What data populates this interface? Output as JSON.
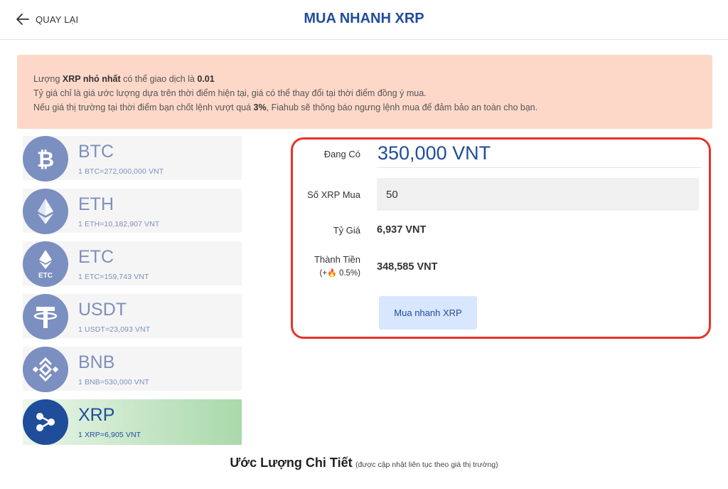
{
  "header": {
    "back_label": "QUAY LẠI",
    "title": "MUA NHANH XRP"
  },
  "notice": {
    "line1_pre": "Lượng ",
    "line1_bold": "XRP nhỏ nhất",
    "line1_mid": " có thể giao dịch là ",
    "line1_value": "0.01",
    "line2": "Tỷ giá chỉ là giá ước lượng dựa trên thời điểm hiện tại, giá có thể thay đổi tại thời điểm đồng ý mua.",
    "line3_pre": "Nếu giá thị trường tại thời điểm bạn chốt lệnh vượt quá ",
    "line3_bold": "3%",
    "line3_post": ", Fiahub sẽ thông báo ngưng lệnh mua để đảm bảo an toàn cho bạn."
  },
  "coins": [
    {
      "name": "BTC",
      "rate": "1 BTC=272,000,000 VNT",
      "icon": "bitcoin-icon"
    },
    {
      "name": "ETH",
      "rate": "1 ETH=10,182,907 VNT",
      "icon": "ethereum-icon"
    },
    {
      "name": "ETC",
      "rate": "1 ETC=159,743 VNT",
      "icon": "ethereum-classic-icon",
      "icon_text": "ETC"
    },
    {
      "name": "USDT",
      "rate": "1 USDT=23,093 VNT",
      "icon": "tether-icon"
    },
    {
      "name": "BNB",
      "rate": "1 BNB=530,000 VNT",
      "icon": "binance-icon"
    },
    {
      "name": "XRP",
      "rate": "1 XRP=6,905 VNT",
      "icon": "ripple-icon",
      "active": true
    }
  ],
  "form": {
    "balance_label": "Đang Có",
    "balance_value": "350,000 VNT",
    "qty_label": "Số XRP Mua",
    "qty_value": "50",
    "rate_label": "Tỷ Giá",
    "rate_value": "6,937 VNT",
    "total_label": "Thành Tiền",
    "fee_pre": "(+",
    "fee_post": " 0.5%)",
    "total_value": "348,585 VNT",
    "buy_button": "Mua nhanh XRP"
  },
  "estimate": {
    "title": "Ước Lượng Chi Tiết",
    "subtitle": "(được cập nhật liên tục theo giá thị trường)"
  },
  "colors": {
    "brand": "#1f4d9a",
    "icon_inactive": "#7b8fc0",
    "notice_bg": "#fdd8c9",
    "highlight_border": "#e8322b",
    "button_bg": "#d8e6ff"
  }
}
